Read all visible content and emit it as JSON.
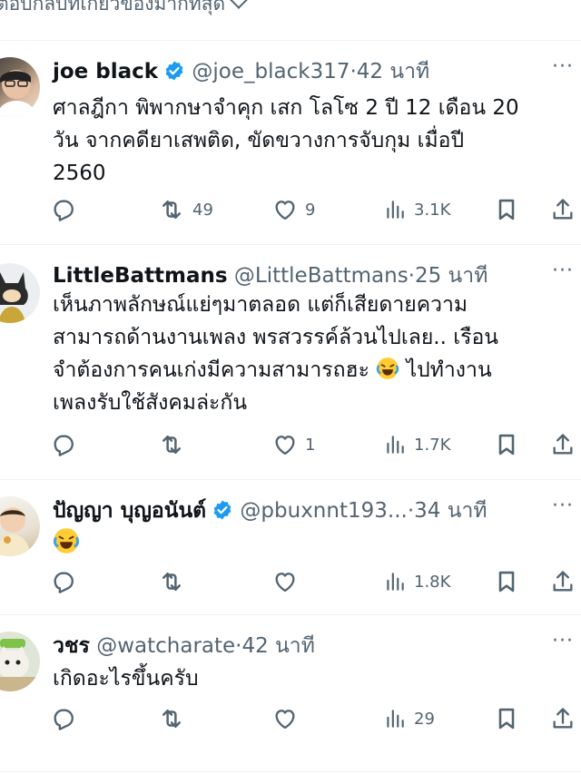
{
  "header": {
    "title": "ตอบกลับที่เกี่ยวข้องมากที่สุด"
  },
  "posts": [
    {
      "name": "joe black",
      "verified": true,
      "handle": "@joe_black317",
      "dot": "·",
      "time": "42 นาที",
      "more": "···",
      "lines": [
        "ศาลฎีกา พิพากษาจำคุก เสก โลโซ 2 ปี 12 เดือน 20",
        "วัน จากคดียาเสพติด, ขัดขวางการจับกุม เมื่อปี",
        "2560"
      ],
      "stats": {
        "reply": "",
        "repost": "49",
        "like": "9",
        "views": "3.1K"
      }
    },
    {
      "name": "LittleBattmans",
      "verified": false,
      "handle": "@LittleBattmans",
      "dot": "·",
      "time": "25 นาที",
      "more": "···",
      "lines": [
        "เห็นภาพลักษณ์แย่ๆมาตลอด แต่ก็เสียดายความ",
        "สามารถด้านงานเพลง พรสวรรค์ล้วนไปเลย..  เรือน",
        "จำต้องการคนเก่งมีความสามารถฮะ",
        "ไปทำงาน",
        "เพลงรับใช้สังคมล่ะกัน"
      ],
      "stats": {
        "reply": "",
        "repost": "",
        "like": "1",
        "views": "1.7K"
      }
    },
    {
      "name": "ปัญญา บุญอนันต์",
      "verified": true,
      "handle": "@pbuxnnt193...",
      "dot": "·",
      "time": "34 นาที",
      "more": "···",
      "lines": [],
      "stats": {
        "reply": "",
        "repost": "",
        "like": "",
        "views": "1.8K"
      }
    },
    {
      "name": "วชร",
      "verified": false,
      "handle": "@watcharate",
      "dot": "·",
      "time": "42 นาที",
      "more": "···",
      "lines": [
        "เกิดอะไรขึ้นครับ"
      ],
      "stats": {
        "reply": "",
        "repost": "",
        "like": "",
        "views": "29"
      }
    }
  ],
  "icons": {
    "verified": "verified-badge-icon",
    "reply": "reply-icon",
    "repost": "repost-icon",
    "like": "like-icon",
    "views": "views-icon",
    "bookmark": "bookmark-icon",
    "share": "share-icon",
    "emoji": "face-with-tears-of-joy-emoji"
  },
  "colors": {
    "verified": "#1d9bf0",
    "secondary": "#536471",
    "text": "#0f1419",
    "divider": "#eff3f4"
  }
}
